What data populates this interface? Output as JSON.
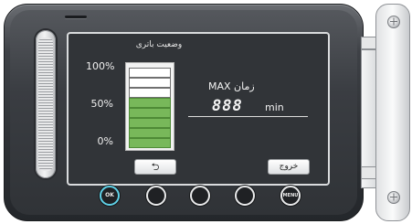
{
  "battery_screen": {
    "title": "وضعیت باتری",
    "levels": [
      "100%",
      "50%",
      "0%"
    ],
    "charge_fraction": 0.6,
    "cells_total": 8,
    "cells_filled": 5,
    "fill_color": "#78b85a"
  },
  "max_time": {
    "label": "زمان MAX",
    "value": "888",
    "unit": "min"
  },
  "screen_buttons": {
    "back_icon": "return-arrow",
    "back_glyph": "⮌",
    "exit_label": "خروج"
  },
  "hardware_buttons": {
    "ok_label": "OK",
    "menu_label": "MENU"
  }
}
